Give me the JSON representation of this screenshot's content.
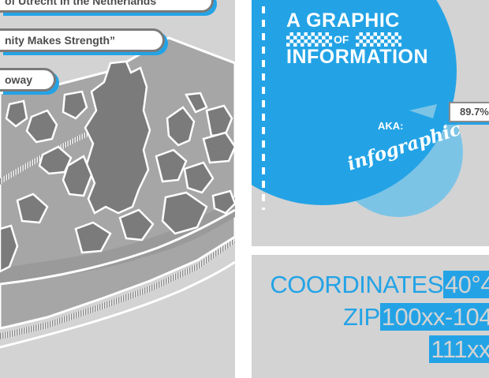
{
  "map_panel": {
    "labels": [
      "of Utrecht in the Netherlands",
      "nity Makes Strength”",
      "oway"
    ]
  },
  "brand_panel": {
    "title_line1": "A GRAPHIC",
    "title_of": "OF",
    "title_line2": "INFORMATION",
    "aka_label": "AKA:",
    "aka_value": "infographic",
    "percent_tag": "89.7%",
    "colors": {
      "blue": "#23a3e6",
      "light_blue": "#7cc4e6",
      "gray": "#d3d3d3"
    }
  },
  "coords_panel": {
    "line1_text": "COORDINATES",
    "line1_highlight": "40°4",
    "line2_text": "ZIP",
    "line2_highlight": "100xx-104",
    "line3_highlight": "111xx"
  }
}
